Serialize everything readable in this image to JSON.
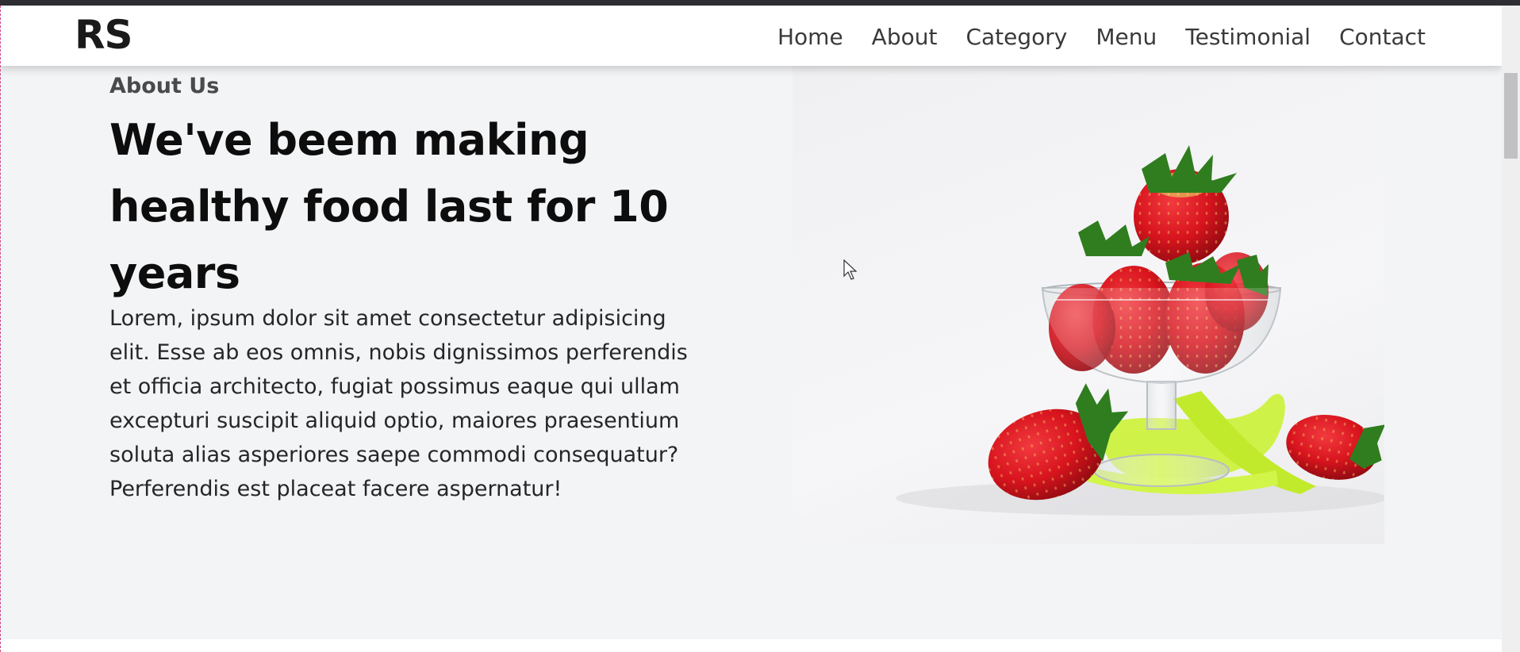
{
  "brand": "RS",
  "nav": [
    "Home",
    "About",
    "Category",
    "Menu",
    "Testimonial",
    "Contact"
  ],
  "about": {
    "eyebrow": "About Us",
    "headline": "We've beem making healthy food last for 10 years",
    "paragraph": "Lorem, ipsum dolor sit amet consectetur adipisicing elit. Esse ab eos omnis, nobis dignissimos perferendis et officia architecto, fugiat possimus eaque qui ullam excepturi suscipit aliquid optio, maiores praesentium soluta alias asperiores saepe commodi consequatur? Perferendis est placeat facere aspernatur!"
  },
  "image": {
    "subject": "strawberries in glass dessert bowl with yellow-green ribbon"
  },
  "colors": {
    "header_bg": "#ffffff",
    "page_bg": "#f3f4f6",
    "heading": "#0d0d0d",
    "text": "#262626",
    "nav_text": "#3a3a3a",
    "strawberry_red": "#d8141e",
    "ribbon_green": "#ccf23a"
  }
}
